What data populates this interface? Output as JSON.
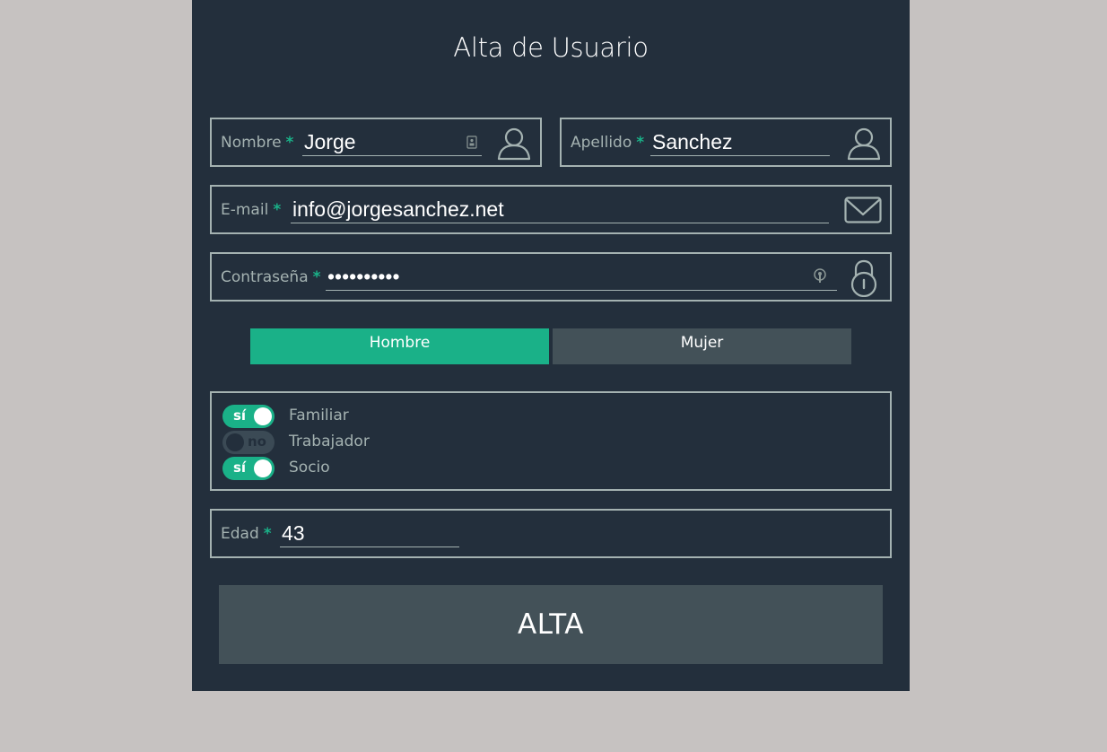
{
  "form": {
    "title": "Alta de Usuario",
    "required_marker": "*",
    "nombre": {
      "label": "Nombre",
      "value": "Jorge"
    },
    "apellido": {
      "label": "Apellido",
      "value": "Sanchez"
    },
    "email": {
      "label": "E-mail",
      "value": "info@jorgesanchez.net"
    },
    "password": {
      "label": "Contraseña",
      "value": "jorgepass1"
    },
    "gender": {
      "options": [
        "Hombre",
        "Mujer"
      ],
      "selected": "Hombre"
    },
    "toggles": [
      {
        "name": "Familiar",
        "state": "sí",
        "on": true
      },
      {
        "name": "Trabajador",
        "state": "no",
        "on": false
      },
      {
        "name": "Socio",
        "state": "sí",
        "on": true
      }
    ],
    "edad": {
      "label": "Edad",
      "value": "43"
    },
    "submit_label": "ALTA"
  },
  "colors": {
    "background": "#c6c2c1",
    "panel": "#232f3c",
    "accent": "#1ab188",
    "border": "#a4b2b1",
    "button": "#435158"
  },
  "icons": {
    "nombre": "user-icon",
    "apellido": "user-icon",
    "email": "envelope-icon",
    "password": "lock-icon"
  }
}
